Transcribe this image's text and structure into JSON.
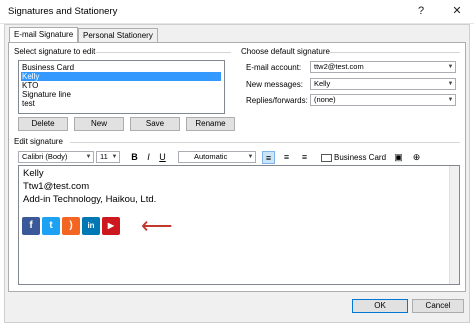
{
  "window": {
    "title": "Signatures and Stationery",
    "help": "?",
    "close": "✕"
  },
  "tabs": [
    {
      "label": "E-mail Signature"
    },
    {
      "label": "Personal Stationery"
    }
  ],
  "select_signature": {
    "heading": "Select signature to edit",
    "items": [
      "Business Card",
      "Kelly",
      "KTO",
      "Signature line",
      "test"
    ],
    "selected": "Kelly"
  },
  "buttons": {
    "delete": "Delete",
    "new": "New",
    "save": "Save",
    "rename": "Rename",
    "ok": "OK",
    "cancel": "Cancel"
  },
  "default_signature": {
    "heading": "Choose default signature",
    "email_account_label": "E-mail account:",
    "email_account_value": "ttw2@test.com",
    "new_messages_label": "New messages:",
    "new_messages_value": "Kelly",
    "replies_label": "Replies/forwards:",
    "replies_value": "(none)"
  },
  "edit_signature": {
    "heading": "Edit signature",
    "font": "Calibri (Body)",
    "size": "11",
    "bold": "B",
    "italic": "I",
    "underline": "U",
    "color": "Automatic",
    "business_card": "Business Card",
    "lines": [
      "Kelly",
      "Ttw1@test.com",
      "Add-in Technology, Haikou, Ltd."
    ],
    "arrow": "⟵"
  },
  "social_icons": [
    {
      "name": "facebook-icon",
      "glyph": "f",
      "color": "#3b5998"
    },
    {
      "name": "twitter-icon",
      "glyph": "t",
      "color": "#1da1f2"
    },
    {
      "name": "rss-icon",
      "glyph": ")",
      "color": "#f26522"
    },
    {
      "name": "linkedin-icon",
      "glyph": "in",
      "color": "#0077b5"
    },
    {
      "name": "youtube-icon",
      "glyph": "▶",
      "color": "#cc181e"
    }
  ],
  "colors": {
    "selection": "#3399ff",
    "arrow": "#c0392b",
    "ok_border": "#0078d7"
  }
}
